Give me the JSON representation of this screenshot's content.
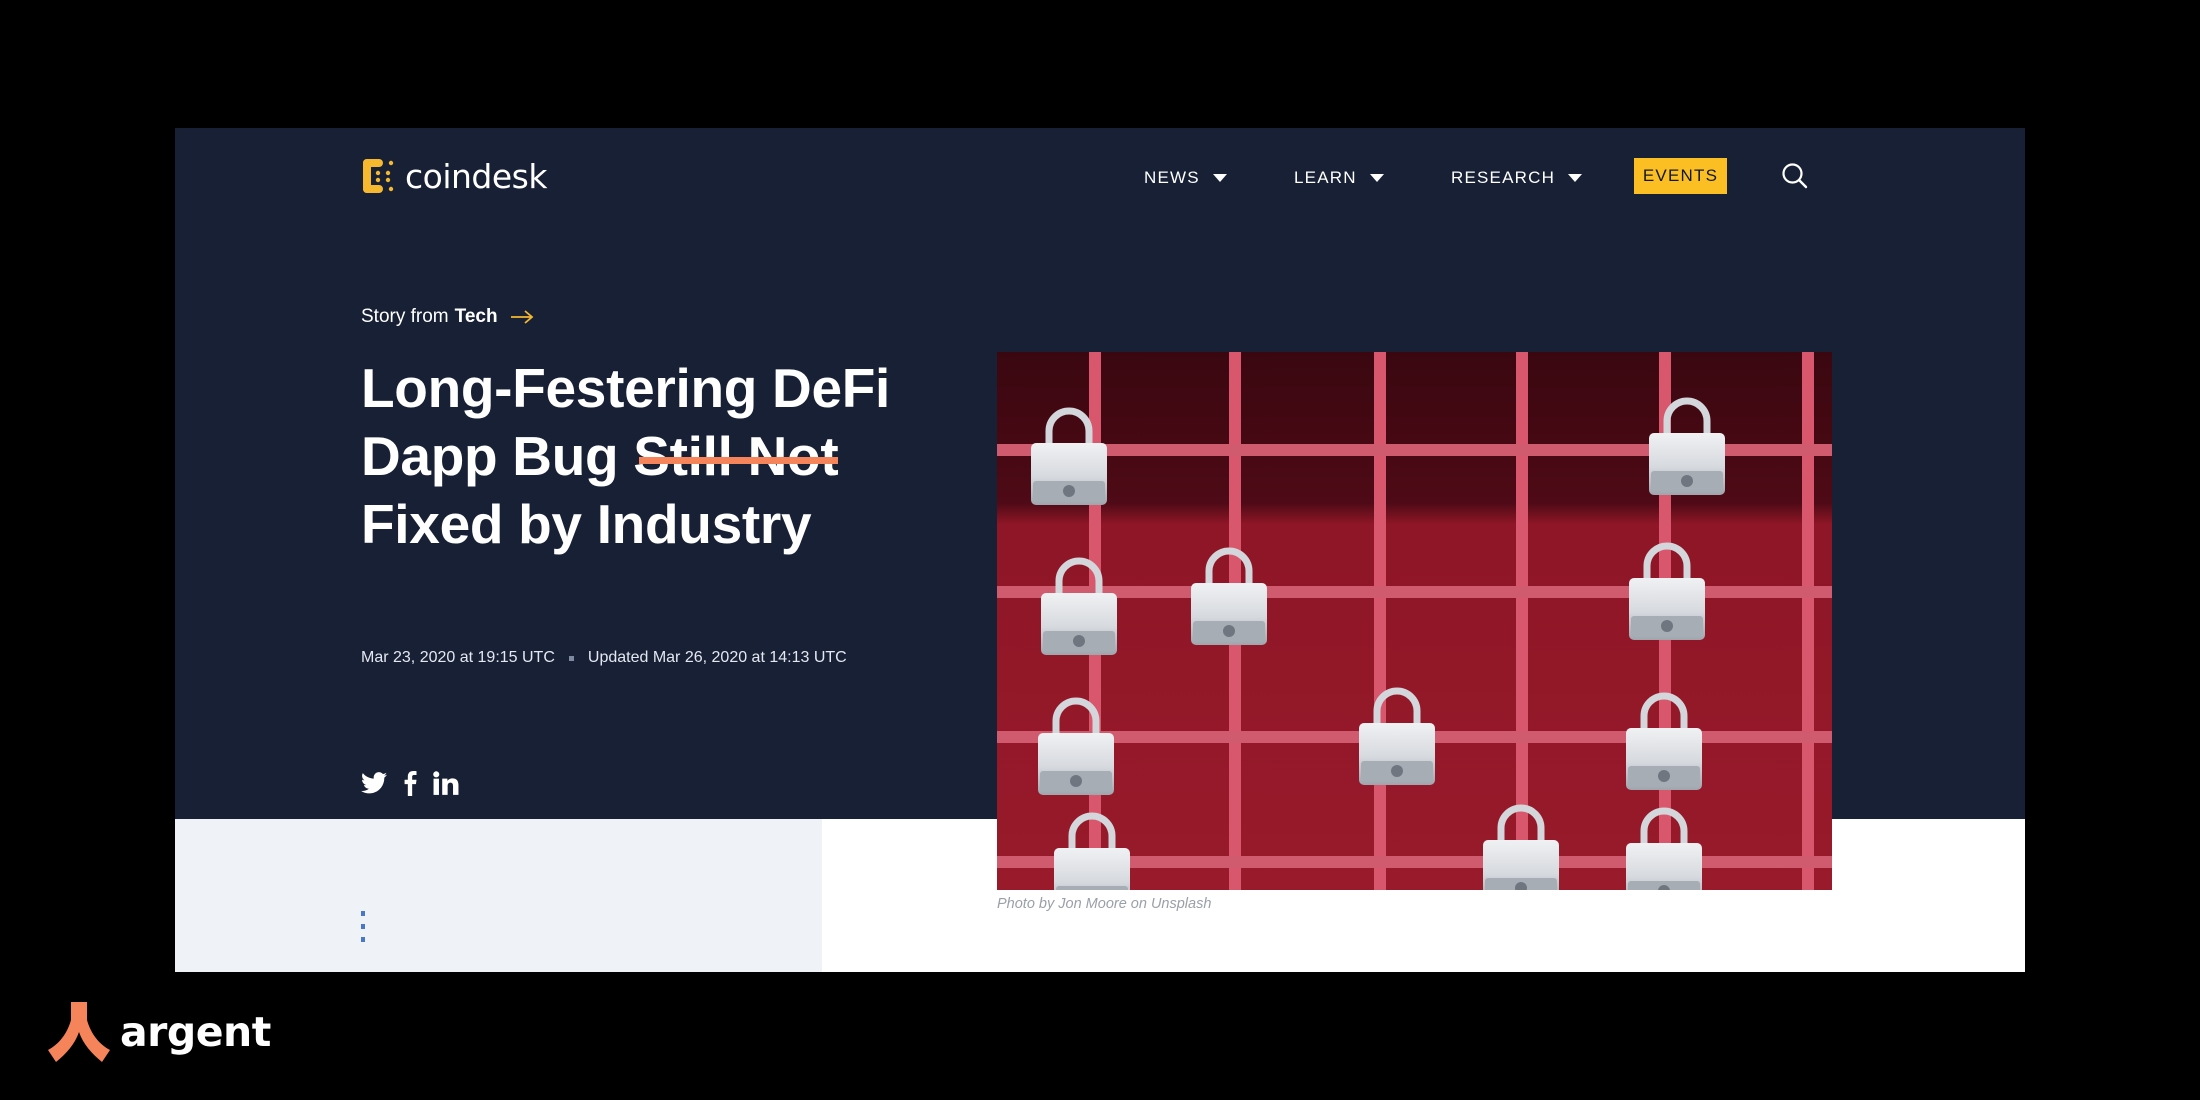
{
  "site": {
    "logo_text": "coindesk",
    "brand_color": "#f5b82e"
  },
  "nav": {
    "items": [
      {
        "label": "NEWS",
        "has_dropdown": true
      },
      {
        "label": "LEARN",
        "has_dropdown": true
      },
      {
        "label": "RESEARCH",
        "has_dropdown": true
      }
    ],
    "events_label": "EVENTS",
    "events_color": "#fbbf24",
    "search_icon": "search-icon"
  },
  "article": {
    "story_from_prefix": "Story from",
    "story_from_section": "Tech",
    "headline": {
      "part1": "Long-Festering DeFi Dapp Bug ",
      "struck": "Still Not",
      "part2": " Fixed by Industry"
    },
    "strike_color": "#f5845a",
    "published": "Mar 23, 2020 at 19:15 UTC",
    "updated": "Updated Mar 26, 2020 at 14:13 UTC",
    "share": [
      "twitter-icon",
      "facebook-icon",
      "linkedin-icon"
    ],
    "photo_caption": "Photo by Jon Moore on Unsplash",
    "more_menu_icon": "kebab-menu-icon"
  },
  "overlay": {
    "brand_text": "argent",
    "brand_color": "#f5845a"
  },
  "colors": {
    "hero_bg": "#182035",
    "light_panel_bg": "#eff3f8",
    "page_bg": "#000000"
  }
}
